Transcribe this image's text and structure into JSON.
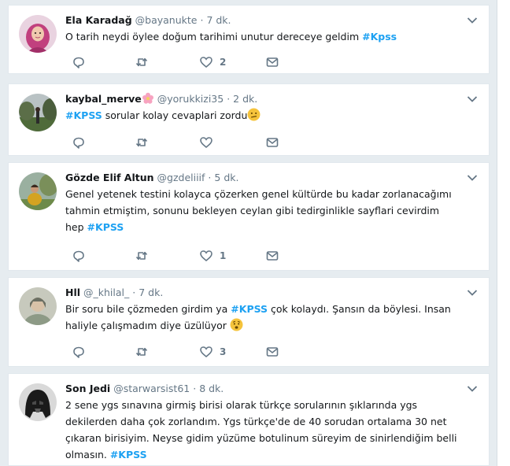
{
  "tweets": [
    {
      "name": "Ela Karadağ",
      "handle": "@bayanukte",
      "separator": "·",
      "time": "7 dk.",
      "text_before": "O tarih neydi öylee doğum tarihimi unutur dereceye geldim ",
      "hashtag": "#Kpss",
      "text_after": "",
      "like_count": "2",
      "avatar_icon": "woman-headscarf-avatar"
    },
    {
      "name": "kaybal_merve",
      "handle": "@yorukkizi35",
      "separator": "·",
      "time": "2 dk.",
      "text_before": "",
      "hashtag": "#KPSS",
      "text_after": " sorular kolay cevaplari zordu",
      "like_count": "",
      "avatar_icon": "park-landscape-avatar"
    },
    {
      "name": "Gözde Elif Altun",
      "handle": "@gzdeliiif",
      "separator": "·",
      "time": "5 dk.",
      "text_before": "Genel yetenek testini kolayca çözerken genel kültürde bu kadar zorlanacağımı tahmin etmiştim, sonunu bekleyen ceylan gibi tedirginlikle sayflari cevirdim hep ",
      "hashtag": "#KPSS",
      "text_after": "",
      "like_count": "1",
      "avatar_icon": "person-outdoors-avatar"
    },
    {
      "name": "Hll",
      "handle": "@_khilal_",
      "separator": "·",
      "time": "7 dk.",
      "text_before": "Bir soru bile çözmeden girdim ya  ",
      "hashtag": "#KPSS",
      "text_after": " çok kolaydı. Şansın da böylesi. Insan haliyle çalışmadım diye üzülüyor ",
      "like_count": "3",
      "avatar_icon": "person-portrait-avatar"
    },
    {
      "name": "Son Jedi",
      "handle": "@starwarsist61",
      "separator": "·",
      "time": "8 dk.",
      "text_before": "2 sene ygs sınavına girmiş birisi olarak türkçe sorularının şıklarında ygs dekilerden daha çok zorlandım. Ygs türkçe'de de 40 sorudan ortalama 30 net çıkaran birisiyim. Neyse gidim yüzüme botulinum süreyim de sinirlendiğim belli olmasın. ",
      "hashtag": "#KPSS",
      "text_after": "",
      "like_count": "",
      "avatar_icon": "darth-vader-avatar"
    }
  ],
  "colors": {
    "hashtag": "#1da1f2",
    "secondary_text": "#657786",
    "background": "#e6ecf0",
    "card": "#ffffff"
  },
  "icons": {
    "reply": "reply-icon",
    "retweet": "retweet-icon",
    "like": "heart-icon",
    "dm": "envelope-icon",
    "menu": "chevron-down-icon",
    "flower_emoji": "flower-emoji-icon",
    "confused_emoji": "confused-face-emoji-icon",
    "worried_emoji": "worried-face-emoji-icon"
  }
}
